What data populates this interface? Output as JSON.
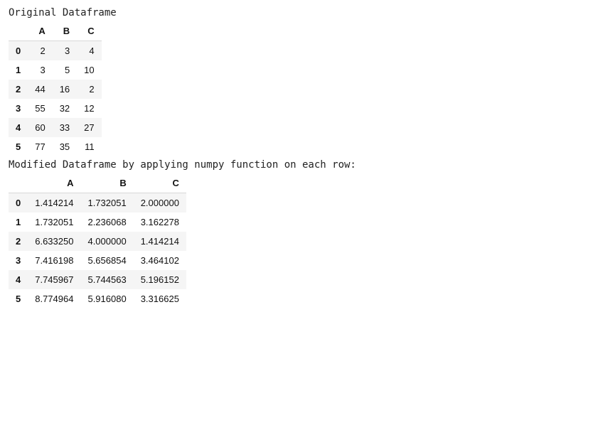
{
  "captions": {
    "original": "Original Dataframe",
    "modified": "Modified Dataframe by applying numpy function on each row:"
  },
  "chart_data": [
    {
      "type": "table",
      "title": "Original Dataframe",
      "columns": [
        "A",
        "B",
        "C"
      ],
      "index": [
        "0",
        "1",
        "2",
        "3",
        "4",
        "5"
      ],
      "rows": [
        [
          "2",
          "3",
          "4"
        ],
        [
          "3",
          "5",
          "10"
        ],
        [
          "44",
          "16",
          "2"
        ],
        [
          "55",
          "32",
          "12"
        ],
        [
          "60",
          "33",
          "27"
        ],
        [
          "77",
          "35",
          "11"
        ]
      ]
    },
    {
      "type": "table",
      "title": "Modified Dataframe by applying numpy function on each row:",
      "columns": [
        "A",
        "B",
        "C"
      ],
      "index": [
        "0",
        "1",
        "2",
        "3",
        "4",
        "5"
      ],
      "rows": [
        [
          "1.414214",
          "1.732051",
          "2.000000"
        ],
        [
          "1.732051",
          "2.236068",
          "3.162278"
        ],
        [
          "6.633250",
          "4.000000",
          "1.414214"
        ],
        [
          "7.416198",
          "5.656854",
          "3.464102"
        ],
        [
          "7.745967",
          "5.744563",
          "5.196152"
        ],
        [
          "8.774964",
          "5.916080",
          "3.316625"
        ]
      ]
    }
  ]
}
